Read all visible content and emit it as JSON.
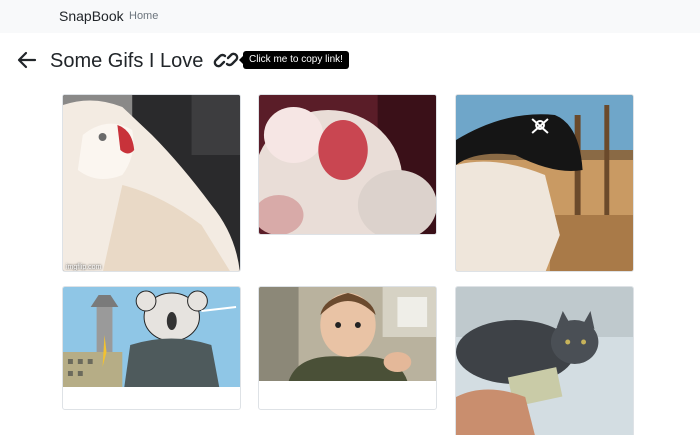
{
  "navbar": {
    "brand": "SnapBook",
    "home": "Home"
  },
  "page": {
    "title": "Some Gifs I Love"
  },
  "copy_link": {
    "tooltip": "Click me to copy link!"
  },
  "gifs": [
    {
      "subject": "white cat screaming",
      "watermark": "imgflip.com"
    },
    {
      "subject": "hamster close-up screaming"
    },
    {
      "subject": "cat in pirate hat on ship"
    },
    {
      "subject": "cartoon koala in sweater"
    },
    {
      "subject": "man staring intensely at camera"
    },
    {
      "subject": "grey kitten grabbing cash"
    }
  ]
}
